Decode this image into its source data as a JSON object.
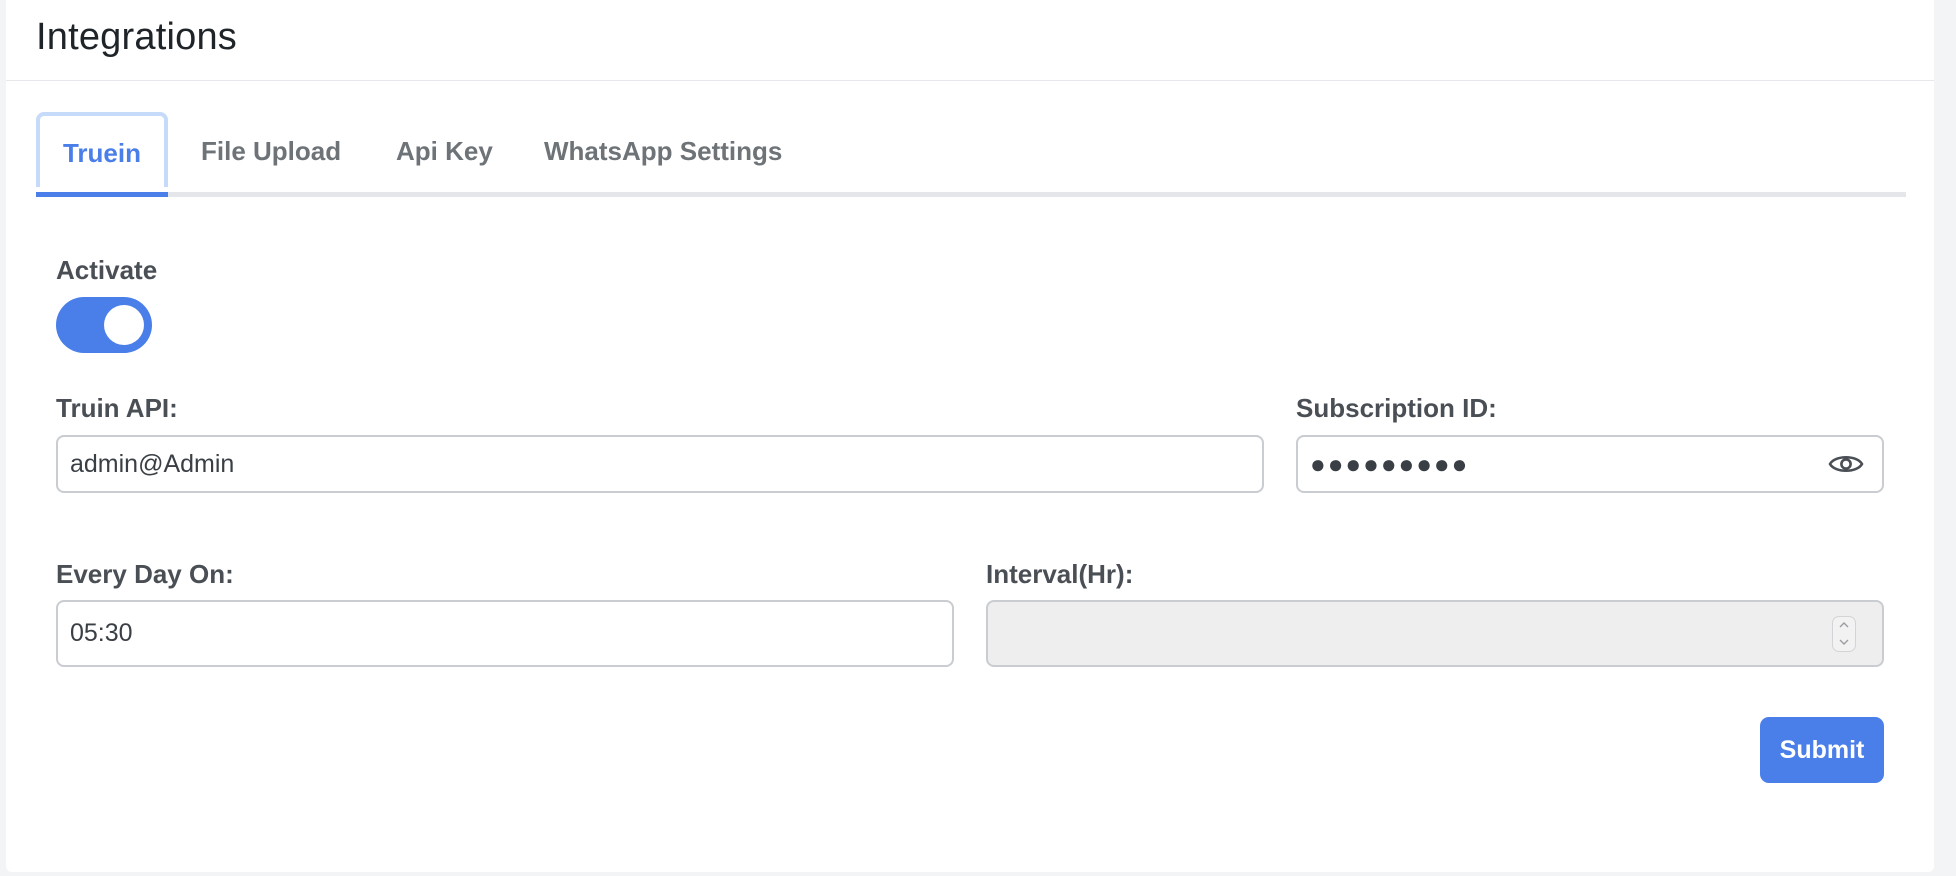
{
  "header": {
    "title": "Integrations"
  },
  "tabs": [
    {
      "label": "Truein",
      "active": true
    },
    {
      "label": "File Upload",
      "active": false
    },
    {
      "label": "Api Key",
      "active": false
    },
    {
      "label": "WhatsApp Settings",
      "active": false
    }
  ],
  "form": {
    "activate": {
      "label": "Activate",
      "checked": true
    },
    "truin_api": {
      "label": "Truin API:",
      "value": "admin@Admin"
    },
    "subscription_id": {
      "label": "Subscription ID:",
      "masked_value": "●●●●●●●●●",
      "toggle_icon": "eye-icon"
    },
    "every_day_on": {
      "label": "Every Day On:",
      "value": "05:30"
    },
    "interval": {
      "label": "Interval(Hr):",
      "value": "",
      "disabled": true
    },
    "submit_label": "Submit"
  },
  "colors": {
    "accent": "#4a7ee8",
    "tab_active_border": "#c6daf9",
    "disabled_bg": "#eeeeee"
  }
}
